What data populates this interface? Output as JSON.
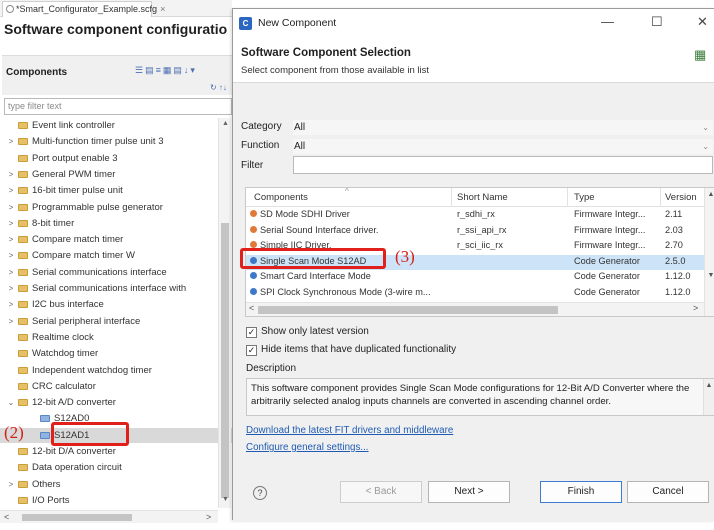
{
  "editor": {
    "tab_label": "*Smart_Configurator_Example.scfg",
    "tab_close": "×",
    "title": "Software component configuratio"
  },
  "components_panel": {
    "header": "Components",
    "toolbar_glyphs": "☰▤≡▦▤↓▾",
    "toolbar2_glyphs": "↻ ↑↓",
    "filter_placeholder": "type filter text",
    "tree": [
      {
        "label": "Event link controller",
        "arrow": "",
        "icon": "folder",
        "indent": 0
      },
      {
        "label": "Multi-function timer pulse unit 3",
        "arrow": ">",
        "icon": "folder",
        "indent": 0
      },
      {
        "label": "Port output enable 3",
        "arrow": "",
        "icon": "folder",
        "indent": 0
      },
      {
        "label": "General PWM timer",
        "arrow": ">",
        "icon": "folder",
        "indent": 0
      },
      {
        "label": "16-bit timer pulse unit",
        "arrow": ">",
        "icon": "folder",
        "indent": 0
      },
      {
        "label": "Programmable pulse generator",
        "arrow": ">",
        "icon": "folder",
        "indent": 0
      },
      {
        "label": "8-bit timer",
        "arrow": ">",
        "icon": "folder",
        "indent": 0
      },
      {
        "label": "Compare match timer",
        "arrow": ">",
        "icon": "folder",
        "indent": 0
      },
      {
        "label": "Compare match timer W",
        "arrow": ">",
        "icon": "folder",
        "indent": 0
      },
      {
        "label": "Serial communications interface",
        "arrow": ">",
        "icon": "folder",
        "indent": 0
      },
      {
        "label": "Serial communications interface with",
        "arrow": ">",
        "icon": "folder",
        "indent": 0
      },
      {
        "label": "I2C bus interface",
        "arrow": ">",
        "icon": "folder",
        "indent": 0
      },
      {
        "label": "Serial peripheral interface",
        "arrow": ">",
        "icon": "folder",
        "indent": 0
      },
      {
        "label": "Realtime clock",
        "arrow": "",
        "icon": "folder",
        "indent": 0
      },
      {
        "label": "Watchdog timer",
        "arrow": "",
        "icon": "folder",
        "indent": 0
      },
      {
        "label": "Independent watchdog timer",
        "arrow": "",
        "icon": "folder",
        "indent": 0
      },
      {
        "label": "CRC calculator",
        "arrow": "",
        "icon": "folder",
        "indent": 0
      },
      {
        "label": "12-bit A/D converter",
        "arrow": "⌄",
        "icon": "folder",
        "indent": 0
      },
      {
        "label": "S12AD0",
        "arrow": "",
        "icon": "component",
        "indent": 1
      },
      {
        "label": "S12AD1",
        "arrow": "",
        "icon": "component",
        "indent": 1,
        "selected": true
      },
      {
        "label": "12-bit D/A converter",
        "arrow": "",
        "icon": "folder",
        "indent": 0
      },
      {
        "label": "Data operation circuit",
        "arrow": "",
        "icon": "folder",
        "indent": 0
      },
      {
        "label": "Others",
        "arrow": ">",
        "icon": "folder",
        "indent": 0
      },
      {
        "label": "I/O Ports",
        "arrow": "",
        "icon": "folder",
        "indent": 0
      }
    ]
  },
  "annotations": {
    "callout_2": "(2)",
    "callout_3": "(3)"
  },
  "dialog": {
    "title": "New Component",
    "app_icon": "C",
    "minimize": "—",
    "maximize": "☐",
    "close": "✕",
    "heading": "Software Component Selection",
    "subheading": "Select component from those available in list",
    "category_label": "Category",
    "category_value": "All",
    "function_label": "Function",
    "function_value": "All",
    "filter_label": "Filter",
    "filter_value": "",
    "table": {
      "columns": [
        "Components",
        "Short Name",
        "Type",
        "Version"
      ],
      "sort_glyph": "^",
      "rows": [
        {
          "name": "SD Mode SDHI Driver",
          "short": "r_sdhi_rx",
          "type": "Firmware Integr...",
          "version": "2.11",
          "icon_color": "#e07a3a"
        },
        {
          "name": "Serial Sound Interface driver.",
          "short": "r_ssi_api_rx",
          "type": "Firmware Integr...",
          "version": "2.03",
          "icon_color": "#e07a3a"
        },
        {
          "name": "Simple IIC Driver.",
          "short": "r_sci_iic_rx",
          "type": "Firmware Integr...",
          "version": "2.70",
          "icon_color": "#e07a3a"
        },
        {
          "name": "Single Scan Mode S12AD",
          "short": "",
          "type": "Code Generator",
          "version": "2.5.0",
          "icon_color": "#3d78c9",
          "selected": true
        },
        {
          "name": "Smart Card Interface Mode",
          "short": "",
          "type": "Code Generator",
          "version": "1.12.0",
          "icon_color": "#3d78c9"
        },
        {
          "name": "SPI Clock Synchronous Mode (3-wire m...",
          "short": "",
          "type": "Code Generator",
          "version": "1.12.0",
          "icon_color": "#3d78c9"
        }
      ]
    },
    "show_latest": "Show only latest version",
    "hide_duplicates": "Hide items that have duplicated functionality",
    "description_label": "Description",
    "description_text": "This software component provides Single Scan Mode configurations for 12-Bit A/D Converter where the arbitrarily selected analog inputs channels are converted in ascending channel order.",
    "link_download": "Download the latest FIT drivers and middleware",
    "link_configure": "Configure general settings...",
    "help_glyph": "?",
    "buttons": {
      "back": "< Back",
      "next": "Next >",
      "finish": "Finish",
      "cancel": "Cancel"
    }
  },
  "colors": {
    "accent": "#3d7bd0",
    "link": "#1f5bb3",
    "callout": "#e0201a",
    "selection": "#cde3f7"
  }
}
